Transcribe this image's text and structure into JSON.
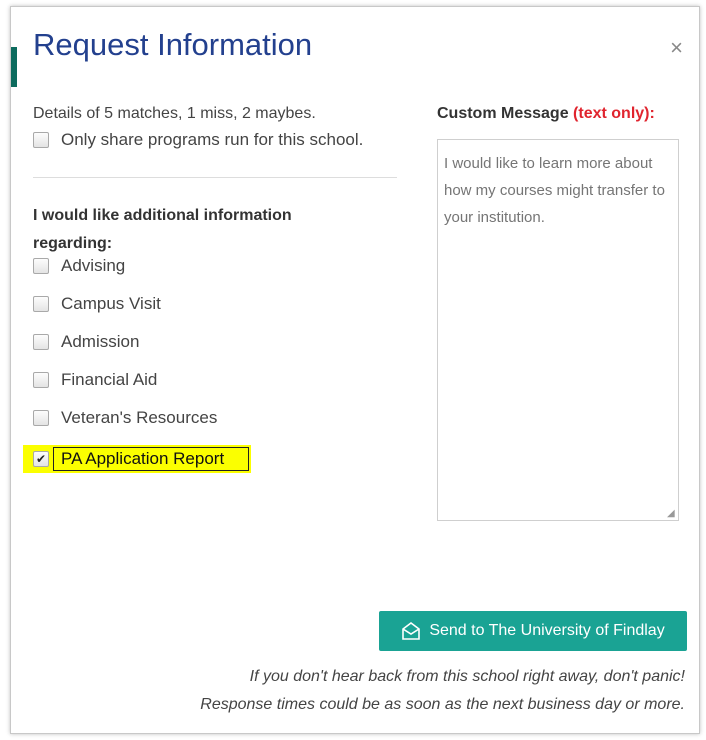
{
  "modal": {
    "title": "Request Information",
    "close_symbol": "×"
  },
  "left": {
    "summary": "Details of 5 matches, 1 miss, 2 maybes.",
    "only_share": {
      "label": "Only share programs run for this school.",
      "checked": false
    },
    "section_label": "I would like additional information regarding:",
    "options": [
      {
        "label": "Advising",
        "checked": false
      },
      {
        "label": "Campus Visit",
        "checked": false
      },
      {
        "label": "Admission",
        "checked": false
      },
      {
        "label": "Financial Aid",
        "checked": false
      },
      {
        "label": "Veteran's Resources",
        "checked": false
      },
      {
        "label": "PA Application Report",
        "checked": true
      }
    ]
  },
  "right": {
    "label": "Custom Message",
    "label_note": "(text only):",
    "placeholder": "I would like to learn more about how my courses might transfer to your institution.",
    "value": ""
  },
  "send_button": {
    "label": "Send to The University of Findlay",
    "icon": "envelope-open-icon"
  },
  "footnotes": [
    "If you don't hear back from this school right away, don't panic!",
    "Response times could be as soon as the next business day or more."
  ],
  "colors": {
    "title": "#23408e",
    "button": "#1aa394",
    "note_red": "#e0242e",
    "highlight": "#fbff00"
  }
}
